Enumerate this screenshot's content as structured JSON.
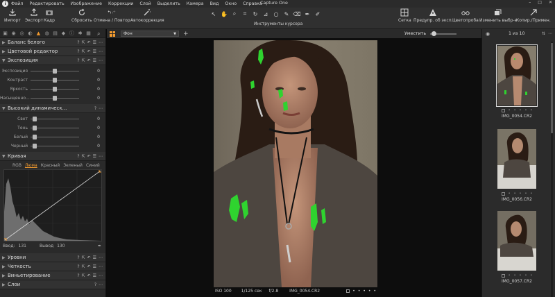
{
  "menubar": {
    "items": [
      "Файл",
      "Редактировать",
      "Изображение",
      "Коррекции",
      "Слой",
      "Выделить",
      "Камера",
      "Вид",
      "Окно",
      "Справка"
    ],
    "title": "Capture One"
  },
  "toolbar": {
    "import": "Импорт",
    "export": "Экспорт",
    "crop": "Кадр",
    "reset": "Сбросить",
    "undo_redo": "Отмена / Повтор",
    "autocorrect": "Автокоррекция",
    "cursor_tools": "Инструменты курсора",
    "grid": "Сетка",
    "exposure_warning": "Предупр. об эксп.",
    "proof": "Цветопроба",
    "edit_selected": "Изменить выбр-е",
    "copy_apply": "Копир./Примен."
  },
  "left": {
    "white_balance": "Баланс белого",
    "color_editor": "Цветовой редактор",
    "exposure": {
      "title": "Экспозиция",
      "rows": [
        {
          "label": "Экспозиция",
          "value": "0",
          "pos": 0.5
        },
        {
          "label": "Контраст",
          "value": "0",
          "pos": 0.5
        },
        {
          "label": "Яркость",
          "value": "0",
          "pos": 0.5
        },
        {
          "label": "Насыщенно...",
          "value": "0",
          "pos": 0.5
        }
      ]
    },
    "hdr": {
      "title": "Высокий динамическ...",
      "rows": [
        {
          "label": "Свет",
          "value": "0",
          "pos": 0.08
        },
        {
          "label": "Тень",
          "value": "0",
          "pos": 0.08
        },
        {
          "label": "Белый",
          "value": "0",
          "pos": 0.08
        },
        {
          "label": "Черный",
          "value": "0",
          "pos": 0.08
        }
      ]
    },
    "curve": {
      "title": "Кривая",
      "tabs": [
        "RGB",
        "Люма",
        "Красный",
        "Зеленый",
        "Синий"
      ],
      "input_label": "Ввод:",
      "input_value": "131",
      "output_label": "Вывод",
      "output_value": "130"
    },
    "levels": "Уровни",
    "clarity": "Четкость",
    "vignetting": "Виньетирование",
    "layers": "Слои"
  },
  "viewer": {
    "layer": "Фон",
    "status": {
      "iso": "ISO 100",
      "shutter": "1/125 сек",
      "aperture": "f/2.8",
      "file": "IMG_0054.CR2"
    }
  },
  "right": {
    "fit": "Уместить",
    "counter": "1 из 10",
    "thumbs": [
      {
        "name": "IMG_0054.CR2",
        "selected": true
      },
      {
        "name": "IMG_0056.CR2",
        "selected": false
      },
      {
        "name": "IMG_0057.CR2",
        "selected": false
      }
    ]
  },
  "colors": {
    "accent": "#f29a2e",
    "highlight_mask": "#2fd32f"
  }
}
